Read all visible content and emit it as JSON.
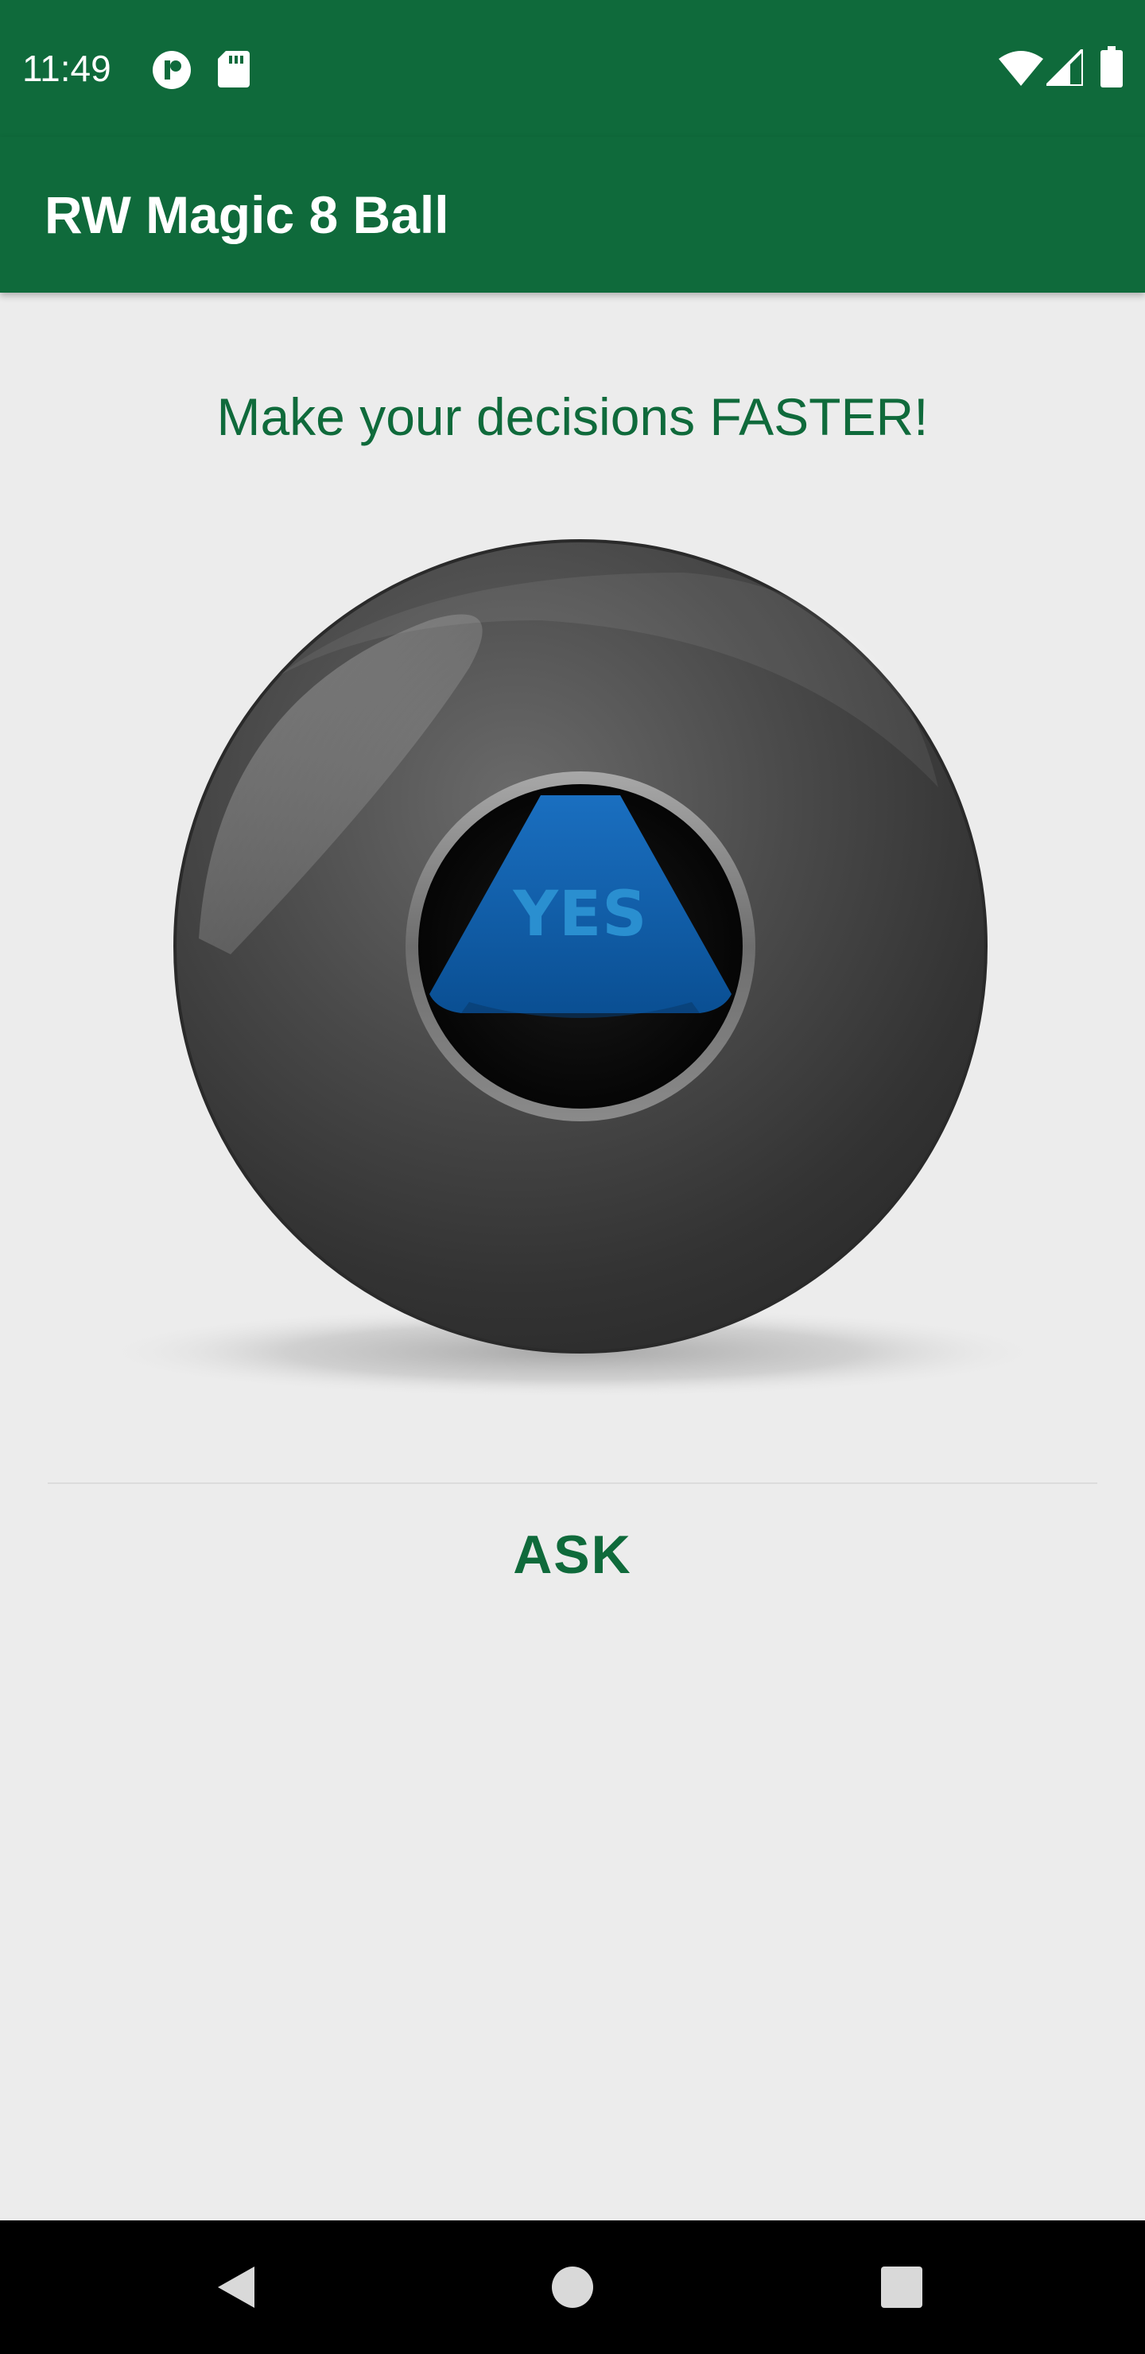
{
  "status_bar": {
    "time": "11:49",
    "icons": [
      "notification-app-icon",
      "sd-card-icon",
      "wifi-icon",
      "cell-signal-icon",
      "battery-icon"
    ]
  },
  "app_bar": {
    "title": "RW Magic 8 Ball"
  },
  "main": {
    "tagline": "Make your decisions FASTER!",
    "answer": "YES",
    "ask_label": "ASK"
  },
  "nav_bar": {
    "icons": [
      "back-icon",
      "home-icon",
      "recents-icon"
    ]
  },
  "colors": {
    "primary": "#0f6a3b",
    "background": "#ececec",
    "answer_blue": "#0a5ea8",
    "answer_text": "#2a8fd0"
  }
}
